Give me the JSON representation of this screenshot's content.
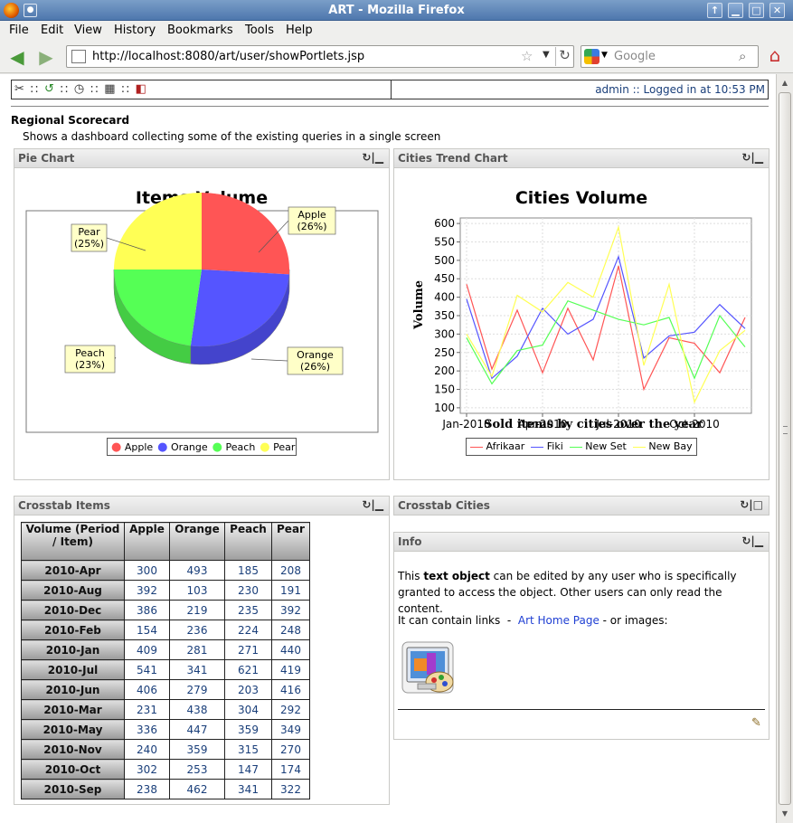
{
  "window": {
    "title": "ART - Mozilla Firefox"
  },
  "menu": [
    "File",
    "Edit",
    "View",
    "History",
    "Bookmarks",
    "Tools",
    "Help"
  ],
  "nav": {
    "url": "http://localhost:8080/art/user/showPortlets.jsp",
    "search_placeholder": "Google"
  },
  "toolbar": {
    "status": "admin :: Logged in at 10:53 PM",
    "separator": "::"
  },
  "section": {
    "title": "Regional Scorecard",
    "description": "Shows a dashboard collecting some of the existing queries in a single screen"
  },
  "portlets": {
    "pie": {
      "title": "Pie Chart"
    },
    "trend": {
      "title": "Cities Trend Chart"
    },
    "crosstab_items": {
      "title": "Crosstab Items"
    },
    "crosstab_cities": {
      "title": "Crosstab Cities"
    },
    "info": {
      "title": "Info",
      "p1_pre": "This ",
      "p1_bold": "text object",
      "p1_post": " can be edited by any user who is specifically granted to access the object. Other users can only read the content.",
      "p2_pre": "It can contain links  -  ",
      "p2_link": "Art Home Page",
      "p2_post": " - or images:"
    }
  },
  "chart_data": [
    {
      "type": "pie",
      "title": "Items Volume",
      "slices": [
        {
          "name": "Apple",
          "pct": 26,
          "label": "Apple (26%)",
          "color": "#ff5555"
        },
        {
          "name": "Orange",
          "pct": 26,
          "label": "Orange (26%)",
          "color": "#5555ff"
        },
        {
          "name": "Peach",
          "pct": 23,
          "label": "Peach (23%)",
          "color": "#55ff55"
        },
        {
          "name": "Pear",
          "pct": 25,
          "label": "Pear (25%)",
          "color": "#ffff55"
        }
      ],
      "legend": [
        "Apple",
        "Orange",
        "Peach",
        "Pear"
      ],
      "legend_position": "bottom"
    },
    {
      "type": "line",
      "title": "Cities Volume",
      "xlabel": "Sold items by cities over the year",
      "ylabel": "Volume",
      "x_tick_labels": [
        "Jan-2010",
        "Apr-2010",
        "Jul-2010",
        "Oct-2010"
      ],
      "x_tick_positions": [
        0,
        3,
        6,
        9
      ],
      "y_ticks": [
        100,
        150,
        200,
        250,
        300,
        350,
        400,
        450,
        500,
        550,
        600
      ],
      "ylim": [
        85,
        615
      ],
      "grid": true,
      "legend_position": "bottom",
      "series": [
        {
          "name": "Afrikaar",
          "color": "#ff5555",
          "values": [
            435,
            205,
            365,
            195,
            370,
            230,
            485,
            150,
            290,
            275,
            195,
            345
          ]
        },
        {
          "name": "Fiki",
          "color": "#5555ff",
          "values": [
            395,
            180,
            240,
            370,
            300,
            340,
            510,
            235,
            295,
            305,
            380,
            315
          ]
        },
        {
          "name": "New Set",
          "color": "#55ff55",
          "values": [
            290,
            165,
            255,
            270,
            390,
            365,
            340,
            325,
            345,
            180,
            350,
            265
          ]
        },
        {
          "name": "New Bay",
          "color": "#ffff55",
          "values": [
            300,
            185,
            405,
            360,
            440,
            400,
            590,
            215,
            435,
            115,
            255,
            310
          ]
        }
      ]
    },
    {
      "type": "table",
      "corner": "Volume (Period / Item)",
      "columns": [
        "Apple",
        "Orange",
        "Peach",
        "Pear"
      ],
      "rows": [
        {
          "label": "2010-Apr",
          "values": [
            300,
            493,
            185,
            208
          ]
        },
        {
          "label": "2010-Aug",
          "values": [
            392,
            103,
            230,
            191
          ]
        },
        {
          "label": "2010-Dec",
          "values": [
            386,
            219,
            235,
            392
          ]
        },
        {
          "label": "2010-Feb",
          "values": [
            154,
            236,
            224,
            248
          ]
        },
        {
          "label": "2010-Jan",
          "values": [
            409,
            281,
            271,
            440
          ]
        },
        {
          "label": "2010-Jul",
          "values": [
            541,
            341,
            621,
            419
          ]
        },
        {
          "label": "2010-Jun",
          "values": [
            406,
            279,
            203,
            416
          ]
        },
        {
          "label": "2010-Mar",
          "values": [
            231,
            438,
            304,
            292
          ]
        },
        {
          "label": "2010-May",
          "values": [
            336,
            447,
            359,
            349
          ]
        },
        {
          "label": "2010-Nov",
          "values": [
            240,
            359,
            315,
            270
          ]
        },
        {
          "label": "2010-Oct",
          "values": [
            302,
            253,
            147,
            174
          ]
        },
        {
          "label": "2010-Sep",
          "values": [
            238,
            462,
            341,
            322
          ]
        }
      ]
    }
  ]
}
